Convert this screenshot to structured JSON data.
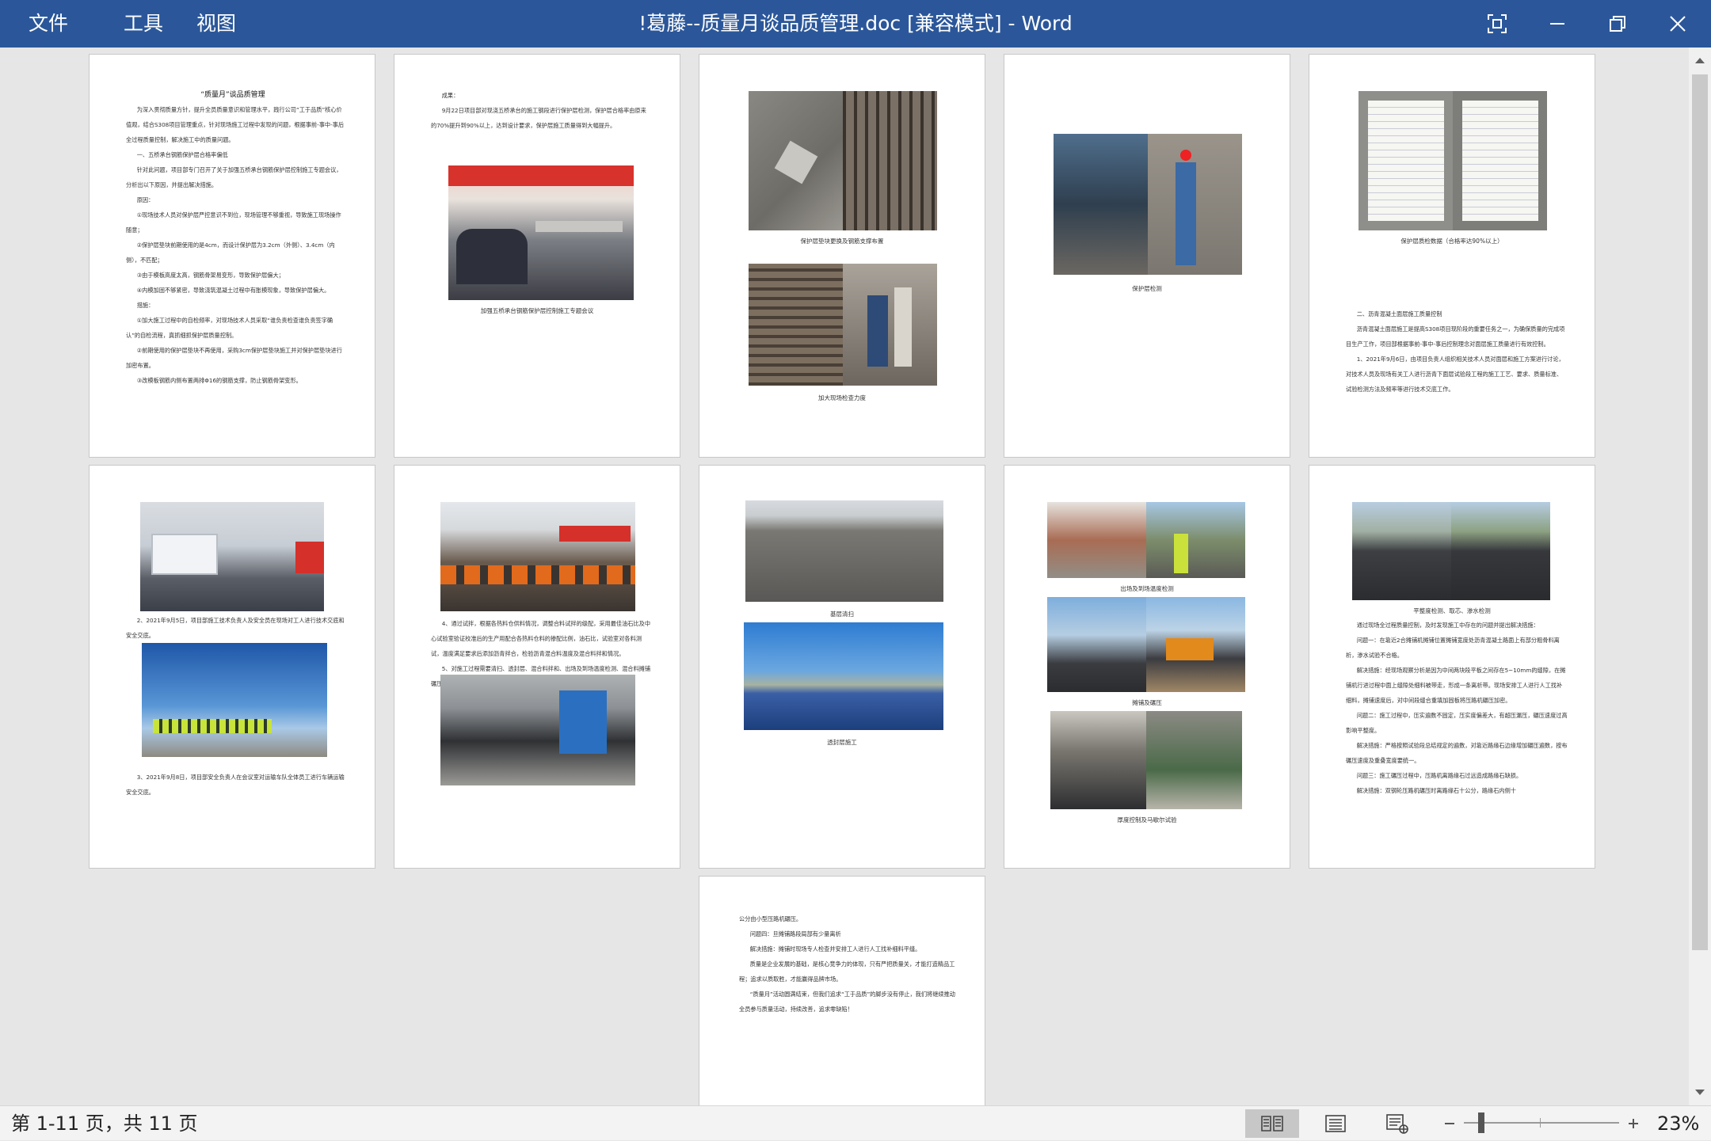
{
  "titlebar": {
    "menu": [
      "文件",
      "工具",
      "视图"
    ],
    "title": "!葛藤--质量月谈品质管理.doc [兼容模式]  -  Word",
    "accent": "#2b579a"
  },
  "pages": {
    "p1": {
      "title": "“质量月”谈品质管理",
      "body": "      为深入贯彻质量方针，提升全员质量意识和管理水平，践行公司“工于品质”核心价值观，结合S308项目管理重点，针对现场施工过程中发现的问题，根据事前-事中-事后全过程质量控制，解决施工中的质量问题。\n      一、五桥承台钢筋保护层合格率偏低\n      针对此问题，项目部专门召开了关于加强五桥承台钢筋保护层控制施工专题会议，分析出以下原因，并提出解决措施。\n      原因：\n      ①现场技术人员对保护层严控意识不到位，现场管理不够重视，导致施工现场操作随意；\n      ②保护层垫块前期使用的是4cm，而设计保护层为3.2cm（外侧）、3.4cm（内侧），不匹配；\n      ③由于模板高度太高，钢筋骨架易变形，导致保护层偏大；\n      ④内模加固不够紧密，导致浇筑混凝土过程中有胀模现象，导致保护层偏大。\n      措施：\n      ①加大施工过程中的自检频率，对现场技术人员采取“谁负责检查谁负责签字确认”的自检流程，真抓细抓保护层质量控制。\n      ②前期使用的保护层垫块不再使用，采购3cm保护层垫块施工并对保护层垫块进行加密布置。\n      ③改模板钢筋内侧布置两排Φ16的钢筋支撑，防止钢筋骨架变形。"
    },
    "p2": {
      "body": "      成果：\n      9月22日项目部对现浇五桥承台的施工钢段进行保护层检测，保护层合格率由原来的70%提升到90%以上，达到设计要求，保护层施工质量得到大幅提升。",
      "caption": "加强五桥承台钢筋保护层控制施工专题会议"
    },
    "p3": {
      "caption1": "保护层垫块更换及钢筋支撑布置",
      "caption2": "加大现场检查力度"
    },
    "p4": {
      "caption": "保护层检测"
    },
    "p5": {
      "caption": "保护层质检数据（合格率达90%以上）",
      "body": "      二、沥青混凝土面层施工质量控制\n      沥青混凝土面层施工是提高S308项目现阶段的重要任务之一，为确保质量的完成项目生产工作，项目部根据事前-事中-事后控制理念对面层施工质量进行有效控制。\n      1、2021年9月6日，由项目负责人组织相关技术人员对面层和施工方案进行讨论，对技术人员及现场有关工人进行沥青下面层试验段工程的施工工艺、要求、质量标准、试验检测方法及频率等进行技术交底工作。"
    },
    "p6": {
      "text1": "      2、2021年9月5日，项目部施工技术负责人及安全员在现场对工人进行技术交底和安全交底。",
      "text2": "      3、2021年9月8日，项目部安全负责人在会议室对运输车队全体员工进行车辆运输安全交底。"
    },
    "p7": {
      "text": "      4、通过试拌，根据各热料仓供料情况，调整合料试拌的级配，采用最佳油石比及中心试验室验证校准后的生产用配合各热料仓料的掺配比例，油石比，试验室对各料测试，温度满足要求后添加沥青拌合，检验沥青混合料温度及混合料拌和情况。\n      5、对施工过程需要清扫、透封层、混合料拌和、出场及到场温度检测、混合料摊铺碾压、各试验检测等全过程跟踪，确保面层施工质量。"
    },
    "p8": {
      "caption1": "基层清扫",
      "caption2": "透封层施工"
    },
    "p9": {
      "caption1": "出场及到场温度检测",
      "caption2": "摊铺及碾压",
      "caption3": "厚度控制及马歇尔试验"
    },
    "p10": {
      "caption": "平整度检测、取芯、渗水检测",
      "body": "      通过现场全过程质量控制，及时发现施工中存在的问题并提出解决措施：\n      问题一：在靠近2合摊铺机摊铺位置摊铺宽度处沥青混凝土路面上有部分粗骨料离析，渗水试验不合格。\n      解决措施：经现场观察分析是因为中间两块段平板之间存在5~10mm的缝隙，在摊铺机行进过程中面上缝隙处细料被带走，形成一条离析带。现场安排工人进行人工找补细料，摊铺速度后，对中间段缝合重填加固板将压路机碾压加密。\n      问题二：施工过程中，压实遍数不固定，压实度偏差大，有超压漏压，碾压速度过高影响平整度。\n      解决措施：严格按照试验段总结规定的遍数，对靠近路缘石边缘增加碾压遍数，按布碾压速度及重叠宽度要统一。\n      问题三：施工碾压过程中，压路机离路缘石过远造成路缘石缺损。\n      解决措施：双钢轮压路机碾压时离路缘石十公分，路缘石内侧十"
    },
    "p11": {
      "body": "公分由小型压路机碾压。\n      问题四：旦摊铺路段局部有少量离析\n      解决措施：摊铺时现场专人检查并安排工人进行人工找补细料平缝。\n      质量是企业发展的基础，是核心竞争力的体现，只有严把质量关，才能打造精品工程；追求以质取胜，才能赢得品牌市场。\n      “质量月”活动圆满结束，但我们追求“工于品质”的脚步没有停止，我们将继续推动全员参与质量活动，持续改善，追求零缺陷！"
    }
  },
  "statusbar": {
    "page_info": "第 1-11 页，共 11 页",
    "zoom": "23%",
    "zoom_level_fraction": 0.23
  }
}
